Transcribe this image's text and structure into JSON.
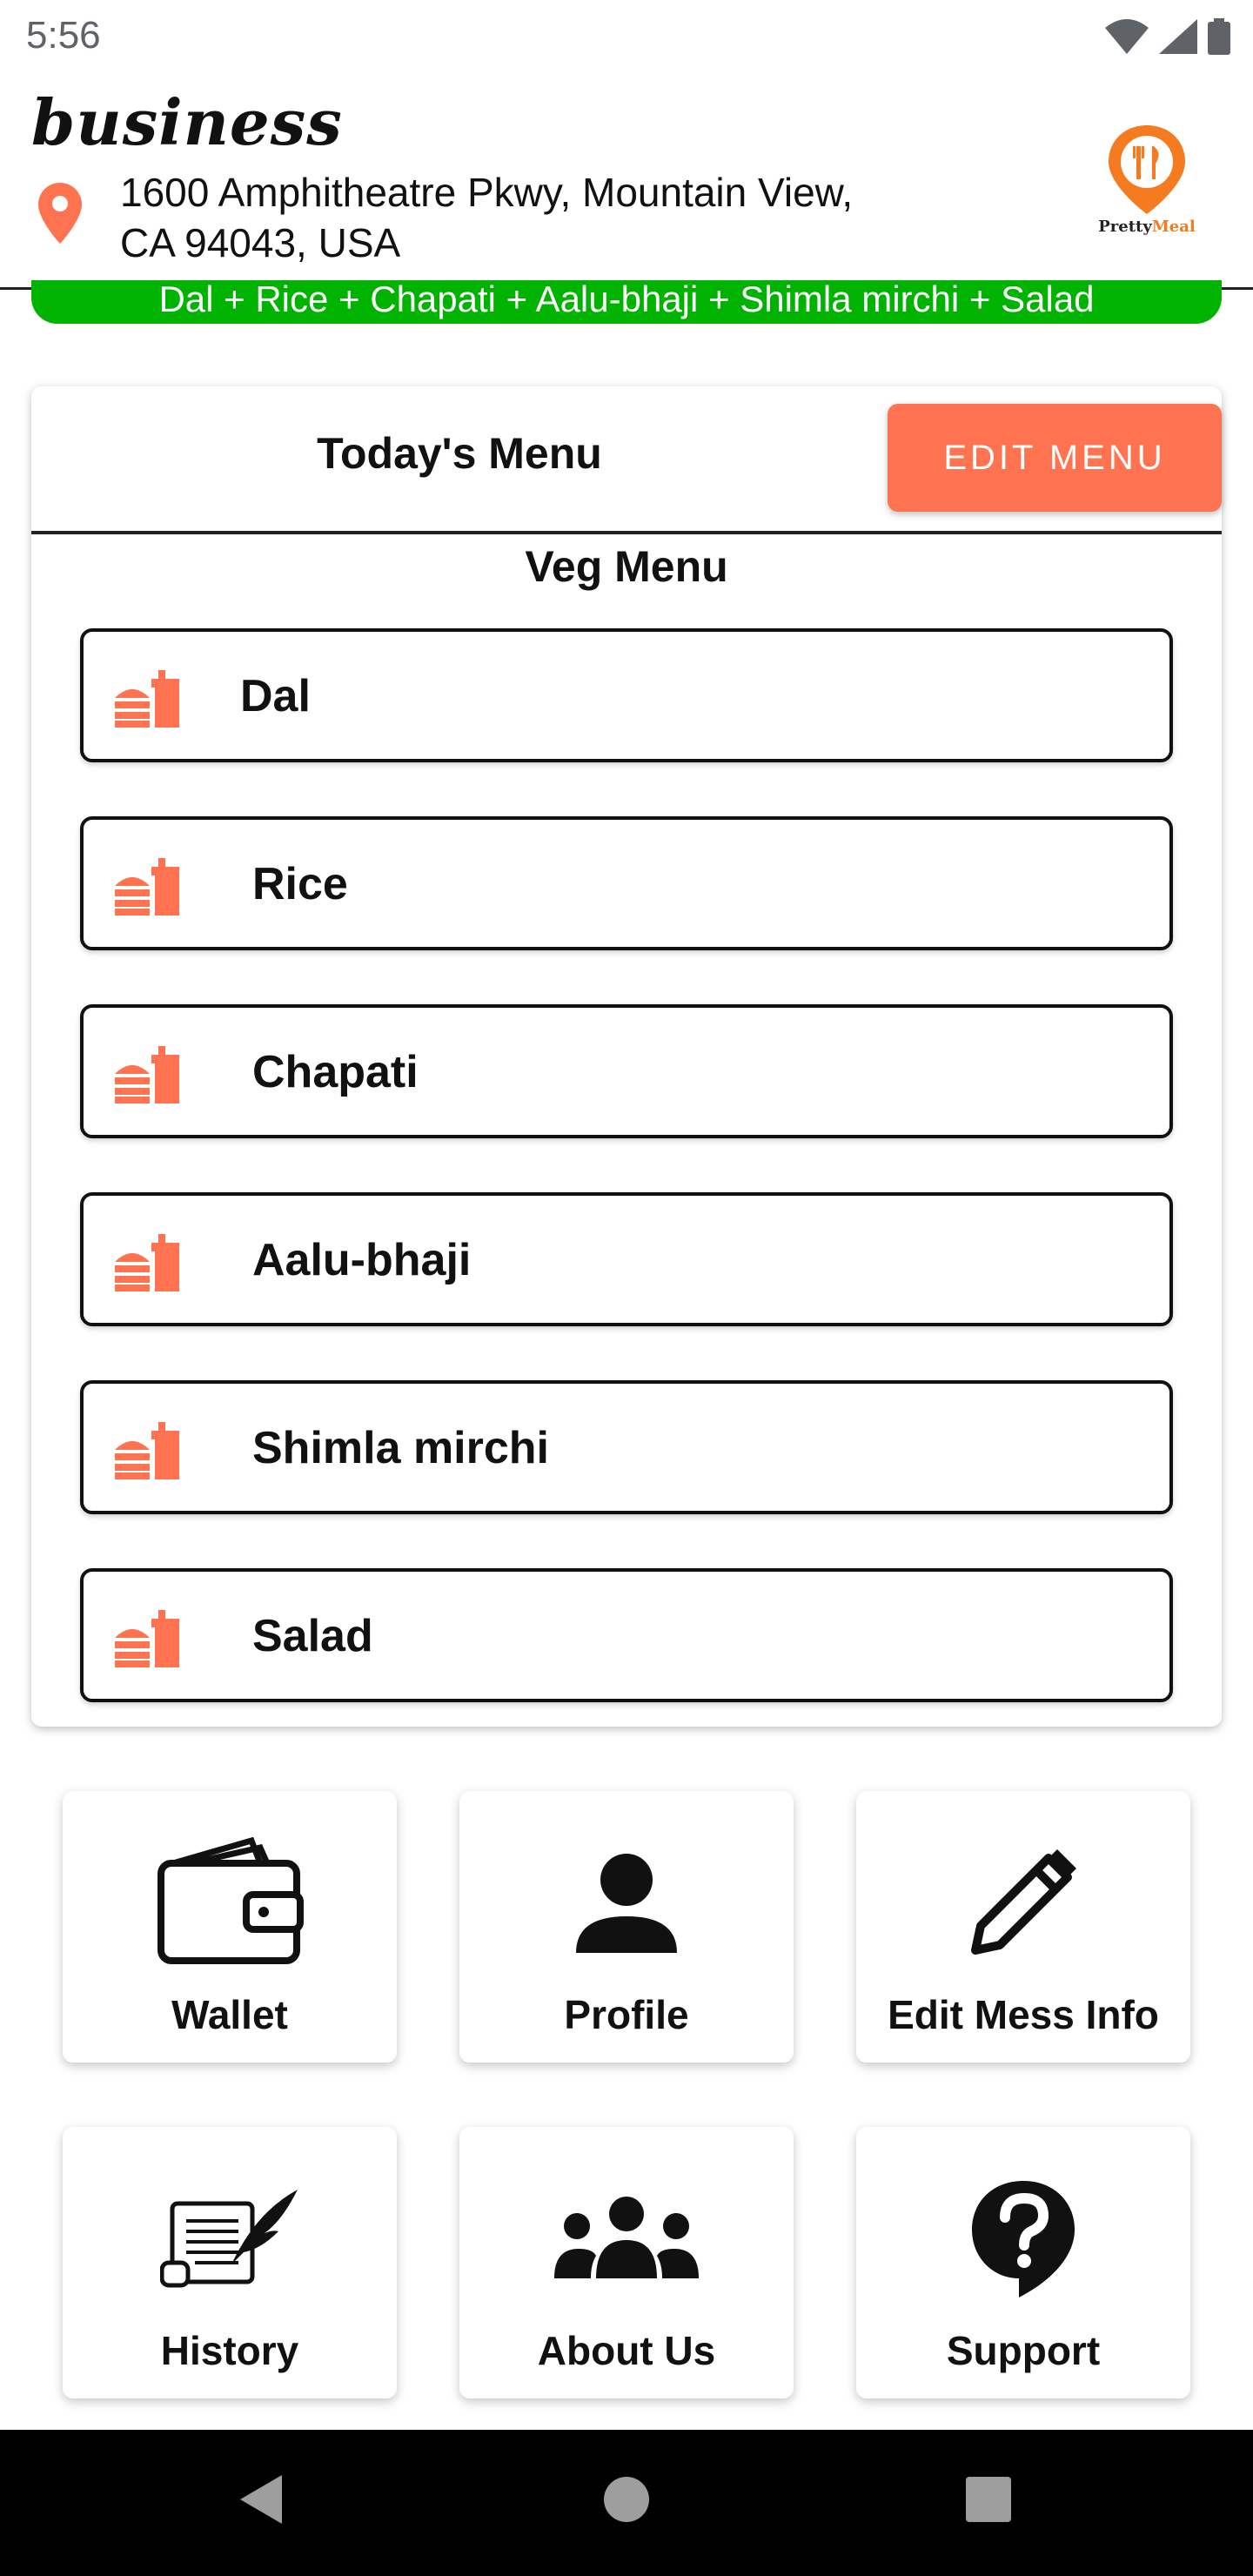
{
  "status_bar": {
    "time": "5:56"
  },
  "header": {
    "business_name": "business",
    "address_line1": "1600 Amphitheatre Pkwy, Mountain View,",
    "address_line2": "CA 94043, USA",
    "logo_text_a": "Pretty",
    "logo_text_b": "Meal"
  },
  "banner": {
    "text": "Dal + Rice + Chapati + Aalu-bhaji + Shimla mirchi + Salad"
  },
  "menu": {
    "title": "Today's Menu",
    "edit_button": "EDIT MENU",
    "section_title": "Veg Menu",
    "items": [
      {
        "label": "Dal"
      },
      {
        "label": "Rice"
      },
      {
        "label": "Chapati"
      },
      {
        "label": "Aalu-bhaji"
      },
      {
        "label": "Shimla mirchi"
      },
      {
        "label": "Salad"
      }
    ]
  },
  "tiles": [
    {
      "label": "Wallet",
      "icon": "wallet-icon"
    },
    {
      "label": "Profile",
      "icon": "person-icon"
    },
    {
      "label": "Edit Mess Info",
      "icon": "pencil-icon"
    },
    {
      "label": "History",
      "icon": "scroll-quill-icon"
    },
    {
      "label": "About Us",
      "icon": "group-icon"
    },
    {
      "label": "Support",
      "icon": "help-icon"
    }
  ],
  "colors": {
    "accent": "#ff7350",
    "banner": "#00b300",
    "logo": "#f47b20",
    "nav": "#000000"
  }
}
